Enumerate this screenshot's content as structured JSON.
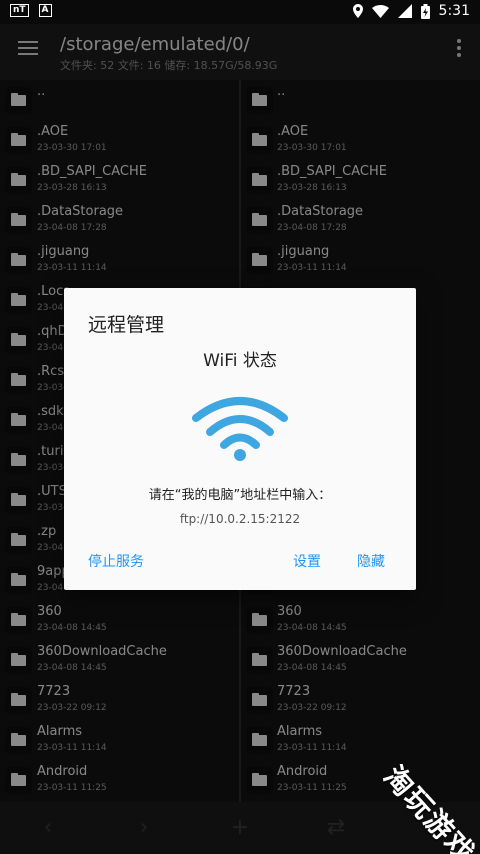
{
  "statusbar": {
    "left_icons": [
      "nt-icon",
      "a-icon"
    ],
    "nt_text": "nT",
    "a_text": "A",
    "time": "5:31"
  },
  "toolbar": {
    "path": "/storage/emulated/0/",
    "summary": "文件夹: 52  文件: 16  储存: 18.57G/58.93G"
  },
  "left_pane": [
    {
      "name": "..",
      "date": ""
    },
    {
      "name": ".AOE",
      "date": "23-03-30 17:01"
    },
    {
      "name": ".BD_SAPI_CACHE",
      "date": "23-03-28 16:13"
    },
    {
      "name": ".DataStorage",
      "date": "23-04-08 17:28"
    },
    {
      "name": ".jiguang",
      "date": "23-03-11 11:14"
    },
    {
      "name": ".Loca",
      "date": "23-04-"
    },
    {
      "name": ".qhD",
      "date": "23-04-"
    },
    {
      "name": ".Rcs",
      "date": "23-03-"
    },
    {
      "name": ".sdk",
      "date": "23-04-"
    },
    {
      "name": ".turin",
      "date": "23-03-"
    },
    {
      "name": ".UTS",
      "date": "23-03-"
    },
    {
      "name": ".zp",
      "date": "23-04-"
    },
    {
      "name": "9app",
      "date": "23-04-01 13:02"
    },
    {
      "name": "360",
      "date": "23-04-08 14:45"
    },
    {
      "name": "360DownloadCache",
      "date": "23-04-08 14:45"
    },
    {
      "name": "7723",
      "date": "23-03-22 09:12"
    },
    {
      "name": "Alarms",
      "date": "23-03-11 11:14"
    },
    {
      "name": "Android",
      "date": "23-03-11 11:25"
    }
  ],
  "right_pane": [
    {
      "name": "..",
      "date": ""
    },
    {
      "name": ".AOE",
      "date": "23-03-30 17:01"
    },
    {
      "name": ".BD_SAPI_CACHE",
      "date": "23-03-28 16:13"
    },
    {
      "name": ".DataStorage",
      "date": "23-04-08 17:28"
    },
    {
      "name": ".jiguang",
      "date": "23-03-11 11:14"
    },
    {
      "name": "",
      "date": ""
    },
    {
      "name": "",
      "date": ""
    },
    {
      "name": "",
      "date": ""
    },
    {
      "name": "",
      "date": ""
    },
    {
      "name": "",
      "date": ""
    },
    {
      "name": "",
      "date": ""
    },
    {
      "name": "",
      "date": ""
    },
    {
      "name": "",
      "date": "23-04-01 13:02"
    },
    {
      "name": "360",
      "date": "23-04-08 14:45"
    },
    {
      "name": "360DownloadCache",
      "date": "23-04-08 14:45"
    },
    {
      "name": "7723",
      "date": "23-03-22 09:12"
    },
    {
      "name": "Alarms",
      "date": "23-03-11 11:14"
    },
    {
      "name": "Android",
      "date": "23-03-11 11:25"
    }
  ],
  "dialog": {
    "title": "远程管理",
    "status": "WiFi 状态",
    "hint": "请在“我的电脑”地址栏中输入：",
    "address": "ftp://10.0.2.15:2122",
    "stop_label": "停止服务",
    "settings_label": "设置",
    "hide_label": "隐藏",
    "accent_color": "#2196f3",
    "wifi_color": "#3ea6e0"
  },
  "bottombar": {
    "back": "‹",
    "forward": "›",
    "add": "+",
    "swap": "⇄",
    "up": "↑"
  },
  "watermark": {
    "chars": [
      "淘",
      "玩",
      "游",
      "戏"
    ]
  }
}
